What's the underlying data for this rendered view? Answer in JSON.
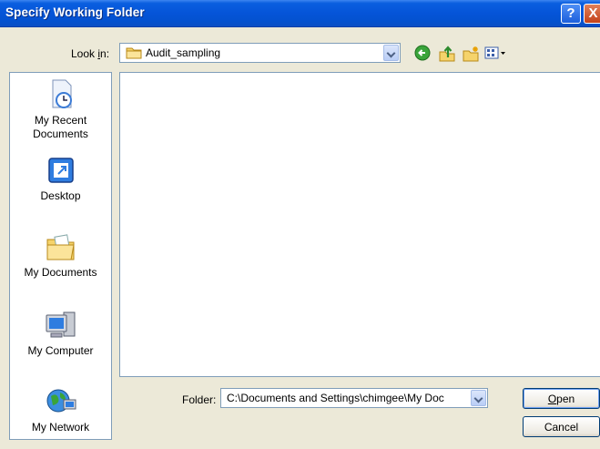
{
  "window": {
    "title": "Specify Working Folder",
    "help_glyph": "?",
    "close_glyph": "X"
  },
  "lookin": {
    "label_prefix": "Look ",
    "label_accel": "i",
    "label_suffix": "n:",
    "value": "Audit_sampling",
    "icon": "folder-icon"
  },
  "toolbar": {
    "icons": [
      "back-icon",
      "up-one-level-icon",
      "new-folder-icon",
      "view-menu-icon"
    ]
  },
  "places": {
    "items": [
      {
        "label": "My Recent\nDocuments",
        "line1": "My Recent",
        "line2": "Documents",
        "icon": "recent-documents-icon"
      },
      {
        "label": "Desktop",
        "icon": "desktop-icon"
      },
      {
        "label": "My Documents",
        "icon": "my-documents-icon"
      },
      {
        "label": "My Computer",
        "icon": "my-computer-icon"
      },
      {
        "label": "My Network",
        "icon": "my-network-icon"
      }
    ]
  },
  "folder": {
    "label": "Folder:",
    "value": "C:\\Documents and Settings\\chimgee\\My Doc"
  },
  "buttons": {
    "open_accel": "O",
    "open_rest": "pen",
    "cancel": "Cancel"
  },
  "colors": {
    "titlebar": "#0554d8",
    "dialog_bg": "#ece9d8",
    "field_border": "#7f9db9"
  }
}
